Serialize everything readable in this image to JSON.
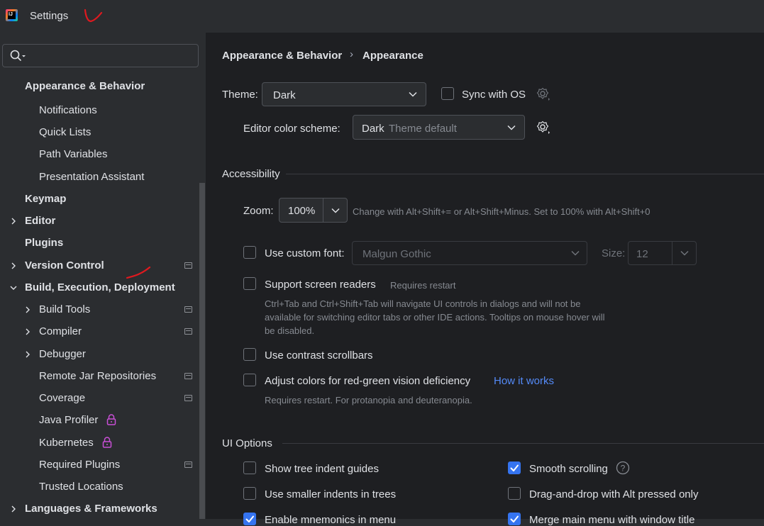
{
  "window": {
    "title": "Settings"
  },
  "search": {
    "placeholder": ""
  },
  "sidebar": {
    "items": [
      {
        "label": "Appearance & Behavior",
        "bold": true
      },
      {
        "label": "Notifications"
      },
      {
        "label": "Quick Lists"
      },
      {
        "label": "Path Variables"
      },
      {
        "label": "Presentation Assistant"
      },
      {
        "label": "Keymap",
        "bold": true
      },
      {
        "label": "Editor",
        "bold": true,
        "expandable": "collapsed"
      },
      {
        "label": "Plugins",
        "bold": true
      },
      {
        "label": "Version Control",
        "bold": true,
        "expandable": "collapsed"
      },
      {
        "label": "Build, Execution, Deployment",
        "bold": true,
        "expandable": "expanded"
      },
      {
        "label": "Build Tools",
        "expandable": "collapsed"
      },
      {
        "label": "Compiler",
        "expandable": "collapsed"
      },
      {
        "label": "Debugger",
        "expandable": "collapsed"
      },
      {
        "label": "Remote Jar Repositories"
      },
      {
        "label": "Coverage"
      },
      {
        "label": "Java Profiler",
        "locked": true
      },
      {
        "label": "Kubernetes",
        "locked": true
      },
      {
        "label": "Required Plugins"
      },
      {
        "label": "Trusted Locations"
      },
      {
        "label": "Languages & Frameworks",
        "bold": true,
        "expandable": "collapsed"
      }
    ]
  },
  "breadcrumb": {
    "parent": "Appearance & Behavior",
    "separator": "›",
    "current": "Appearance"
  },
  "theme": {
    "label": "Theme:",
    "value": "Dark",
    "sync_label": "Sync with OS",
    "sync_checked": false
  },
  "editor_scheme": {
    "label": "Editor color scheme:",
    "value": "Dark",
    "value_hint": "Theme default"
  },
  "accessibility": {
    "title": "Accessibility",
    "zoom_label": "Zoom:",
    "zoom_value": "100%",
    "zoom_hint": "Change with Alt+Shift+= or Alt+Shift+Minus. Set to 100% with Alt+Shift+0",
    "custom_font_label": "Use custom font:",
    "custom_font_checked": false,
    "custom_font_value": "Malgun Gothic",
    "size_label": "Size:",
    "size_value": "12",
    "screen_readers_label": "Support screen readers",
    "screen_readers_checked": false,
    "screen_readers_hint": "Requires restart",
    "screen_readers_desc1": "Ctrl+Tab and Ctrl+Shift+Tab will navigate UI controls in dialogs and will not be",
    "screen_readers_desc2": "available for switching editor tabs or other IDE actions. Tooltips on mouse hover will",
    "screen_readers_desc3": "be disabled.",
    "contrast_scrollbars_label": "Use contrast scrollbars",
    "contrast_scrollbars_checked": false,
    "color_deficiency_label": "Adjust colors for red-green vision deficiency",
    "color_deficiency_checked": false,
    "how_it_works": "How it works",
    "color_deficiency_hint": "Requires restart. For protanopia and deuteranopia."
  },
  "ui_options": {
    "title": "UI Options",
    "indent_guides_label": "Show tree indent guides",
    "indent_guides_checked": false,
    "smaller_indents_label": "Use smaller indents in trees",
    "smaller_indents_checked": false,
    "mnemonics_label": "Enable mnemonics in menu",
    "mnemonics_checked": true,
    "smooth_scrolling_label": "Smooth scrolling",
    "smooth_scrolling_checked": true,
    "drag_drop_label": "Drag-and-drop with Alt pressed only",
    "drag_drop_checked": false,
    "merge_menu_label": "Merge main menu with window title",
    "merge_menu_checked": true
  },
  "colors": {
    "accent": "#3574f0",
    "link": "#548af7",
    "annotation": "#e0191f"
  }
}
